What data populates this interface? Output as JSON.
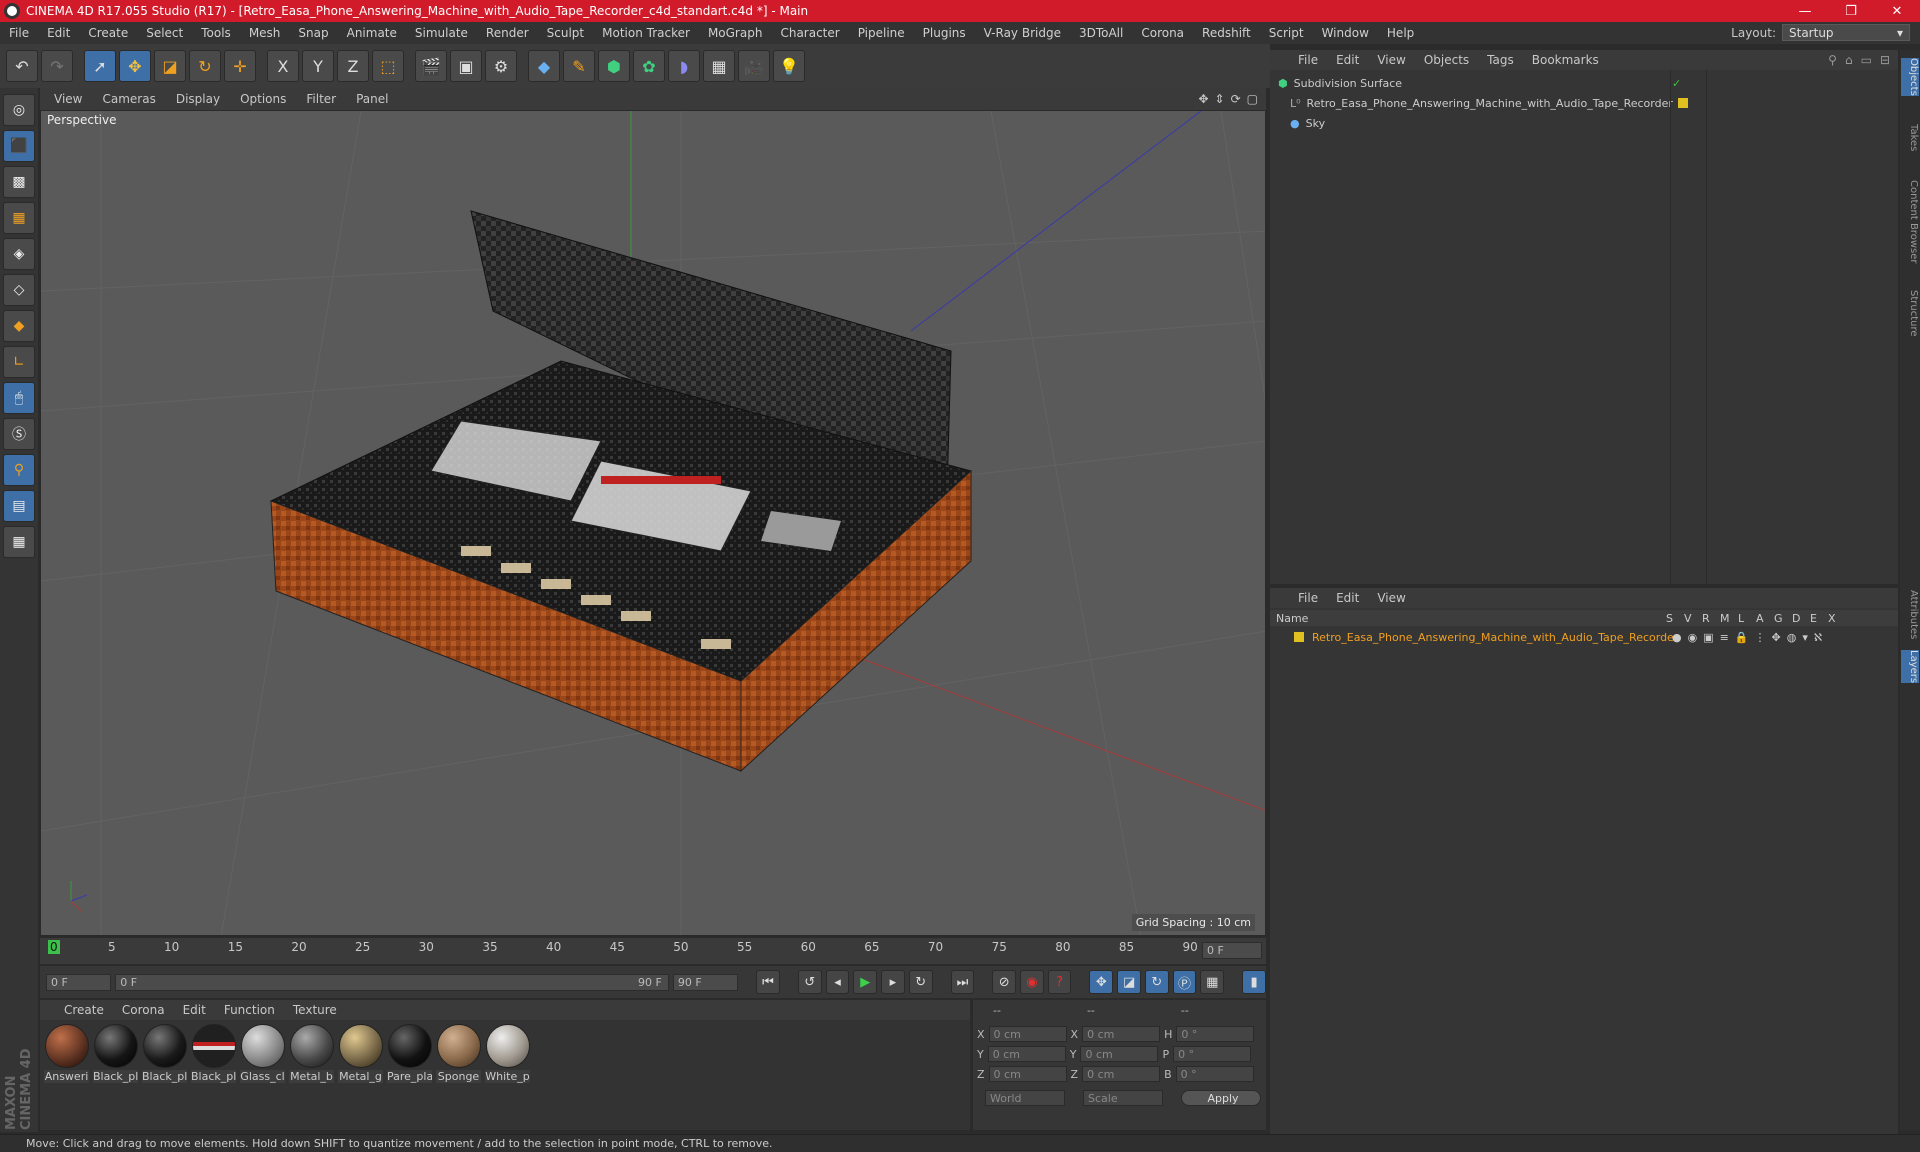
{
  "window": {
    "title": "CINEMA 4D R17.055 Studio (R17) - [Retro_Easa_Phone_Answering_Machine_with_Audio_Tape_Recorder_c4d_standart.c4d *] - Main",
    "minimize": "—",
    "restore": "❐",
    "close": "✕"
  },
  "menubar": {
    "items": [
      "File",
      "Edit",
      "Create",
      "Select",
      "Tools",
      "Mesh",
      "Snap",
      "Animate",
      "Simulate",
      "Render",
      "Sculpt",
      "Motion Tracker",
      "MoGraph",
      "Character",
      "Pipeline",
      "Plugins",
      "V-Ray Bridge",
      "3DToAll",
      "Corona",
      "Redshift",
      "Script",
      "Window",
      "Help"
    ],
    "layout_label": "Layout:",
    "layout_value": "Startup"
  },
  "toolbar": {
    "icons": [
      "undo-icon",
      "redo-icon",
      "select-icon",
      "move-icon",
      "scale-icon",
      "rotate-icon",
      "live-select-icon",
      "x-axis-icon",
      "y-axis-icon",
      "z-axis-icon",
      "coordinate-system-icon",
      "render-view-icon",
      "render-picture-viewer-icon",
      "render-settings-icon",
      "cube-icon",
      "pen-icon",
      "subdivision-icon",
      "mograph-cloner-icon",
      "deformer-icon",
      "floor-icon",
      "camera-icon",
      "light-icon"
    ],
    "x_label": "X",
    "y_label": "Y",
    "z_label": "Z"
  },
  "viewport": {
    "menu": [
      "View",
      "Cameras",
      "Display",
      "Options",
      "Filter",
      "Panel"
    ],
    "label": "Perspective",
    "grid_spacing": "Grid Spacing : 10 cm"
  },
  "timeline": {
    "ticks": [
      "0",
      "5",
      "10",
      "15",
      "20",
      "25",
      "30",
      "35",
      "40",
      "45",
      "50",
      "55",
      "60",
      "65",
      "70",
      "75",
      "80",
      "85",
      "90"
    ],
    "current_frame": "0 F",
    "start_field": "0 F",
    "slider_start": "0 F",
    "slider_end": "90 F",
    "end_field": "90 F"
  },
  "materials": {
    "menu": [
      "Create",
      "Corona",
      "Edit",
      "Function",
      "Texture"
    ],
    "items": [
      {
        "label": "Answeri",
        "color": "#5a3020"
      },
      {
        "label": "Black_pl",
        "color": "#151515"
      },
      {
        "label": "Black_pl",
        "color": "#1a1a1a"
      },
      {
        "label": "Black_pl",
        "color": "#202020"
      },
      {
        "label": "Glass_cl",
        "color": "#8a8a8a"
      },
      {
        "label": "Metal_b",
        "color": "#4a4a4a"
      },
      {
        "label": "Metal_g",
        "color": "#7a6a4a"
      },
      {
        "label": "Pare_pla",
        "color": "#121212"
      },
      {
        "label": "Sponge",
        "color": "#8a6a4a"
      },
      {
        "label": "White_p",
        "color": "#a09a90"
      }
    ]
  },
  "coordinates": {
    "headers": [
      "--",
      "--",
      "--"
    ],
    "pos_x": "0 cm",
    "pos_y": "0 cm",
    "pos_z": "0 cm",
    "size_x": "0 cm",
    "size_y": "0 cm",
    "size_z": "0 cm",
    "rot_h": "0 °",
    "rot_p": "0 °",
    "rot_b": "0 °",
    "labels": {
      "x": "X",
      "y": "Y",
      "z": "Z",
      "h": "H",
      "p": "P",
      "b": "B"
    },
    "mode_world": "World",
    "mode_scale": "Scale",
    "apply": "Apply"
  },
  "object_manager": {
    "menu": [
      "File",
      "Edit",
      "View",
      "Objects",
      "Tags",
      "Bookmarks"
    ],
    "objects": [
      {
        "name": "Subdivision Surface",
        "color": "#ccc"
      },
      {
        "name": "Retro_Easa_Phone_Answering_Machine_with_Audio_Tape_Recorder",
        "color": "#ccc"
      },
      {
        "name": "Sky",
        "color": "#ccc"
      }
    ]
  },
  "layer_manager": {
    "menu": [
      "File",
      "Edit",
      "View"
    ],
    "header_name": "Name",
    "columns": [
      "S",
      "V",
      "R",
      "M",
      "L",
      "A",
      "G",
      "D",
      "E",
      "X"
    ],
    "layer_name": "Retro_Easa_Phone_Answering_Machine_with_Audio_Tape_Recorder",
    "layer_color": "#e0c020"
  },
  "right_tabs": [
    "Objects",
    "Takes",
    "Content Browser",
    "Structure",
    "Attributes",
    "Layers"
  ],
  "status": "Move: Click and drag to move elements. Hold down SHIFT to quantize movement / add to the selection in point mode, CTRL to remove.",
  "brand": "MAXON CINEMA 4D"
}
